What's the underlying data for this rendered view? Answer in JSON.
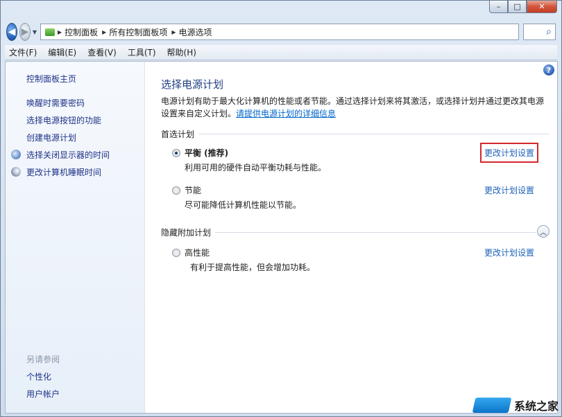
{
  "window": {
    "caption": {
      "minimize": "–",
      "maximize": "□",
      "close": "✕"
    }
  },
  "nav": {
    "back_glyph": "◀",
    "forward_glyph": "▶",
    "history_glyph": "▼",
    "breadcrumbs": [
      "控制面板",
      "所有控制面板项",
      "电源选项"
    ],
    "crumb_sep": "▶",
    "search_glyph": "⌕"
  },
  "menubar": {
    "items": [
      "文件(F)",
      "编辑(E)",
      "查看(V)",
      "工具(T)",
      "帮助(H)"
    ]
  },
  "sidebar": {
    "home": "控制面板主页",
    "links": [
      "唤醒时需要密码",
      "选择电源按钮的功能",
      "创建电源计划",
      "选择关闭显示器的时间",
      "更改计算机睡眠时间"
    ],
    "see_also_title": "另请参阅",
    "see_also": [
      "个性化",
      "用户帐户"
    ]
  },
  "main": {
    "help": "?",
    "title": "选择电源计划",
    "description": "电源计划有助于最大化计算机的性能或者节能。通过选择计划来将其激活，或选择计划并通过更改其电源设置来自定义计划。",
    "description_link": "请提供电源计划的详细信息",
    "preferred_header": "首选计划",
    "hidden_header": "隐藏附加计划",
    "collapse_glyph": "︿",
    "plans": [
      {
        "name": "平衡 (推荐)",
        "desc": "利用可用的硬件自动平衡功耗与性能。",
        "link": "更改计划设置",
        "checked": true
      },
      {
        "name": "节能",
        "desc": "尽可能降低计算机性能以节能。",
        "link": "更改计划设置",
        "checked": false
      },
      {
        "name": "高性能",
        "desc": "有利于提高性能，但会增加功耗。",
        "link": "更改计划设置",
        "checked": false
      }
    ]
  },
  "watermark": {
    "text": "系统之家"
  }
}
